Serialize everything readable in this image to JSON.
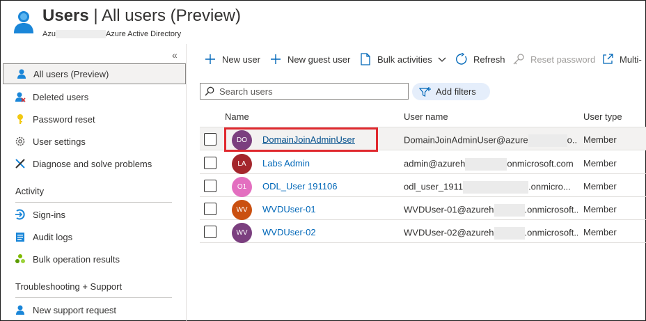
{
  "header": {
    "title_main": "Users",
    "title_rest": " | All users (Preview)",
    "subtitle_prefix": "Azu",
    "subtitle_suffix": "Azure Active Directory"
  },
  "sidebar": {
    "collapse": "«",
    "items": [
      {
        "label": "All users (Preview)",
        "icon": "user-icon"
      },
      {
        "label": "Deleted users",
        "icon": "deleted-user-icon"
      },
      {
        "label": "Password reset",
        "icon": "key-icon"
      },
      {
        "label": "User settings",
        "icon": "gear-icon"
      },
      {
        "label": "Diagnose and solve problems",
        "icon": "wrench-icon"
      }
    ],
    "activity_header": "Activity",
    "activity_items": [
      {
        "label": "Sign-ins",
        "icon": "sign-in-icon"
      },
      {
        "label": "Audit logs",
        "icon": "audit-log-icon"
      },
      {
        "label": "Bulk operation results",
        "icon": "bulk-results-icon"
      }
    ],
    "support_header": "Troubleshooting + Support",
    "support_items": [
      {
        "label": "New support request",
        "icon": "support-request-icon"
      }
    ]
  },
  "toolbar": {
    "new_user": "New user",
    "new_guest_user": "New guest user",
    "bulk_activities": "Bulk activities",
    "refresh": "Refresh",
    "reset_password": "Reset password",
    "multi": "Multi-"
  },
  "search": {
    "placeholder": "Search users",
    "value": ""
  },
  "add_filters": "Add filters",
  "table": {
    "headers": {
      "name": "Name",
      "user_name": "User name",
      "user_type": "User type"
    },
    "rows": [
      {
        "initials": "DO",
        "color": "#7b3f7f",
        "name": "DomainJoinAdminUser",
        "user_name": "DomainJoinAdminUser@azure",
        "user_name_tail": "o...",
        "user_type": "Member"
      },
      {
        "initials": "LA",
        "color": "#a4262c",
        "name": "Labs Admin",
        "user_name": "admin@azureh",
        "user_name_tail": "onmicrosoft.com",
        "user_type": "Member"
      },
      {
        "initials": "O1",
        "color": "#e36fc0",
        "name": "ODL_User 191106",
        "user_name": "odl_user_1911",
        "user_name_tail": ".onmicro...",
        "user_type": "Member"
      },
      {
        "initials": "WV",
        "color": "#ca5010",
        "name": "WVDUser-01",
        "user_name": "WVDUser-01@azureh",
        "user_name_tail": ".onmicrosoft...",
        "user_type": "Member"
      },
      {
        "initials": "WV",
        "color": "#7b3f7f",
        "name": "WVDUser-02",
        "user_name": "WVDUser-02@azureh",
        "user_name_tail": ".onmicrosoft...",
        "user_type": "Member"
      }
    ]
  }
}
